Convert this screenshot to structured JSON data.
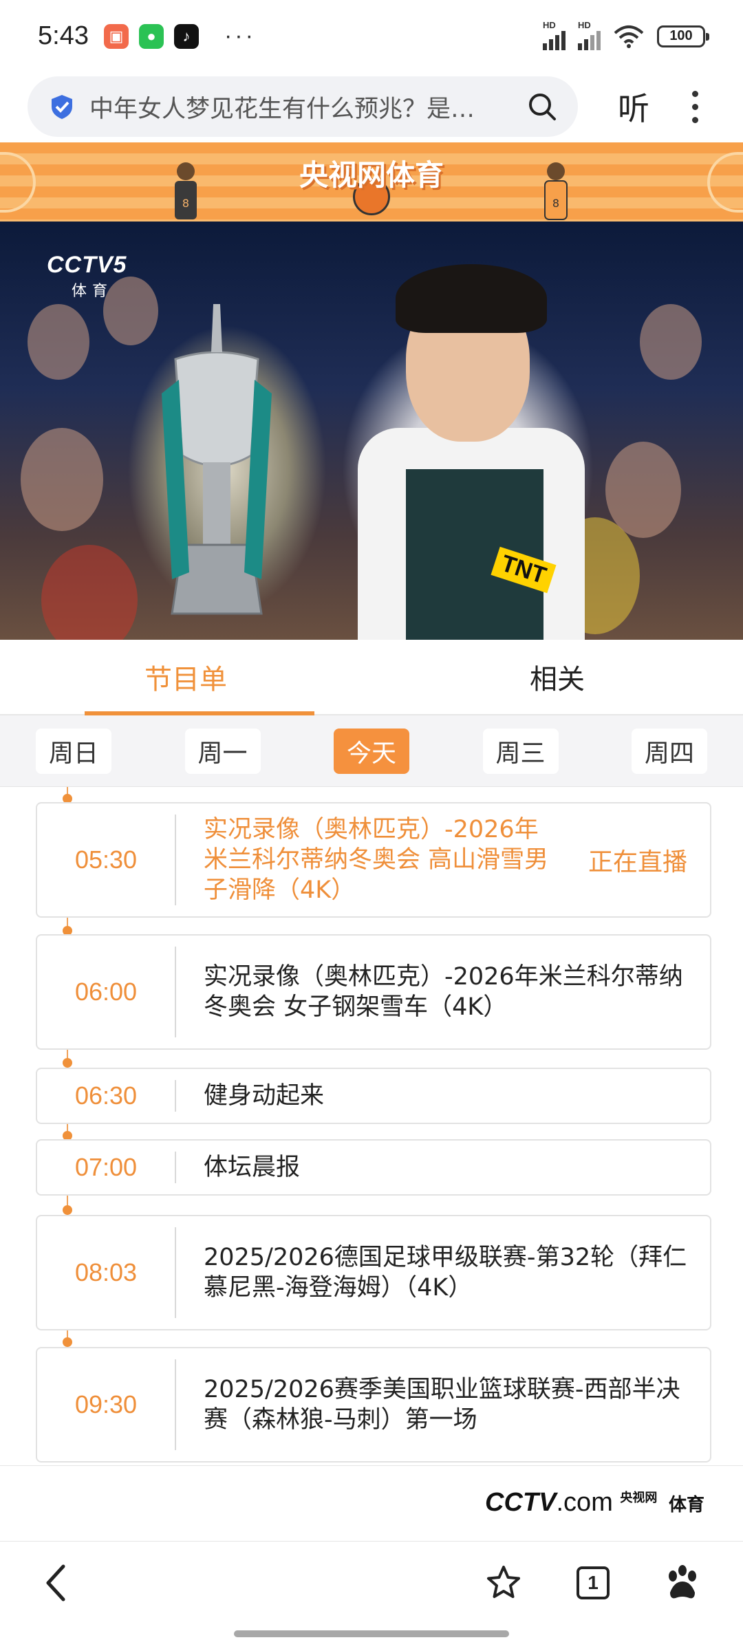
{
  "status_bar": {
    "time": "5:43",
    "network1": "HD",
    "network2": "HD",
    "battery": "100",
    "more": "···"
  },
  "address_bar": {
    "query": "中年女人梦见花生有什么预兆？是…",
    "listen_label": "听"
  },
  "banner": {
    "title": "央视网体育"
  },
  "video": {
    "channel_logo": "CCTV5",
    "channel_sub": "体育",
    "sponsor_text": "TNT"
  },
  "tabs": [
    {
      "label": "节目单",
      "active": true
    },
    {
      "label": "相关",
      "active": false
    }
  ],
  "days": [
    {
      "label": "周日"
    },
    {
      "label": "周一"
    },
    {
      "label": "今天",
      "selected": true
    },
    {
      "label": "周三"
    },
    {
      "label": "周四"
    }
  ],
  "programs": [
    {
      "time": "05:30",
      "title": "实况录像（奥林匹克）-2026年米兰科尔蒂纳冬奥会 高山滑雪男子滑降（4K）",
      "live": true,
      "live_label": "正在直播"
    },
    {
      "time": "06:00",
      "title": "实况录像（奥林匹克）-2026年米兰科尔蒂纳冬奥会 女子钢架雪车（4K）"
    },
    {
      "time": "06:30",
      "title": "健身动起来"
    },
    {
      "time": "07:00",
      "title": "体坛晨报"
    },
    {
      "time": "08:03",
      "title": "2025/2026德国足球甲级联赛-第32轮（拜仁慕尼黑-海登海姆）（4K）"
    },
    {
      "time": "09:30",
      "title": "2025/2026赛季美国职业篮球联赛-西部半决赛（森林狼-马刺）第一场"
    }
  ],
  "footer": {
    "brand": "CCTV",
    "brand_com": ".com",
    "brand_small": "央视网",
    "brand_sub": "体育"
  },
  "nav": {
    "tab_count": "1"
  },
  "colors": {
    "accent": "#f0913a",
    "banner": "#f7a04a"
  }
}
